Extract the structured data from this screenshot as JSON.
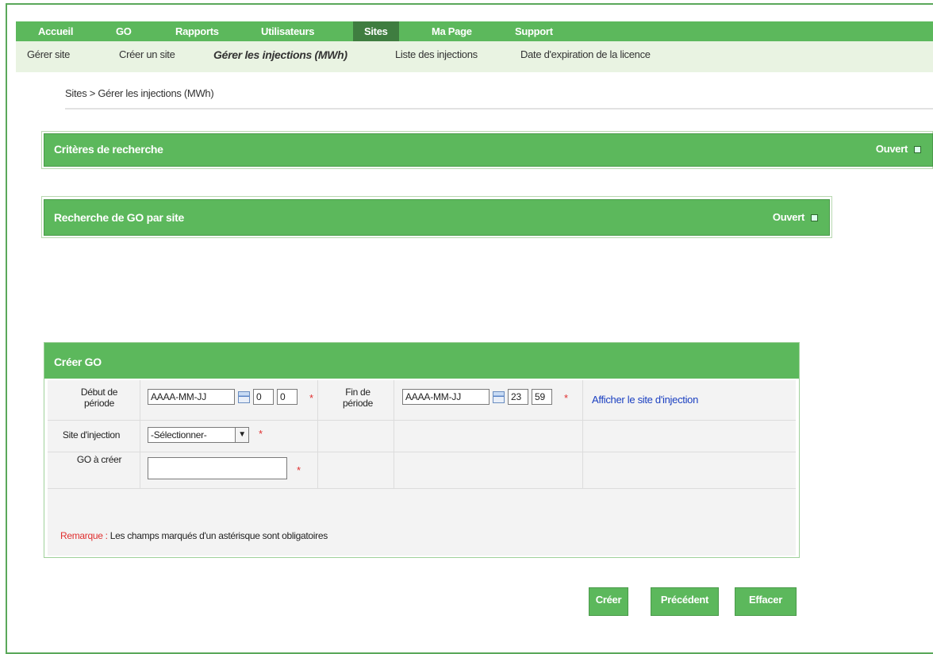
{
  "topnav": {
    "items": [
      {
        "label": "Accueil"
      },
      {
        "label": "GO"
      },
      {
        "label": "Rapports"
      },
      {
        "label": "Utilisateurs"
      },
      {
        "label": "Sites"
      },
      {
        "label": "Ma Page"
      },
      {
        "label": "Support"
      }
    ],
    "active": "Sites"
  },
  "subnav": {
    "items": [
      {
        "label": "Gérer site"
      },
      {
        "label": "Créer un site"
      },
      {
        "label": "Gérer les injections (MWh)"
      },
      {
        "label": "Liste des injections"
      },
      {
        "label": "Date d'expiration de la licence"
      }
    ],
    "active": "Gérer les injections (MWh)"
  },
  "breadcrumb": "Sites > Gérer les injections (MWh)",
  "panels": {
    "search_criteria": {
      "title": "Critères de recherche",
      "state": "Ouvert"
    },
    "search_go_by_site": {
      "title": "Recherche de GO par site",
      "state": "Ouvert"
    }
  },
  "create_go": {
    "title": "Créer GO",
    "start_label": "Début de période",
    "start_date_placeholder": "AAAA-MM-JJ",
    "start_hour": "0",
    "start_minute": "0",
    "end_label": "Fin de période",
    "end_date_placeholder": "AAAA-MM-JJ",
    "end_hour": "23",
    "end_minute": "59",
    "show_site_link": "Afficher le site d'injection",
    "site_label": "Site d'injection",
    "site_selected": "-Sélectionner-",
    "go_label": "GO à créer",
    "go_value": "",
    "required_mark": "*",
    "remark_label": "Remarque :",
    "remark_text": "Les champs marqués d'un astérisque sont obligatoires"
  },
  "buttons": {
    "create": "Créer",
    "previous": "Précédent",
    "clear": "Effacer"
  },
  "colors": {
    "accent": "#5cb85c",
    "active_tab": "#3f7d40",
    "subnav_bg": "#e9f3e2",
    "required": "#e03030",
    "link": "#1a3fc1"
  }
}
